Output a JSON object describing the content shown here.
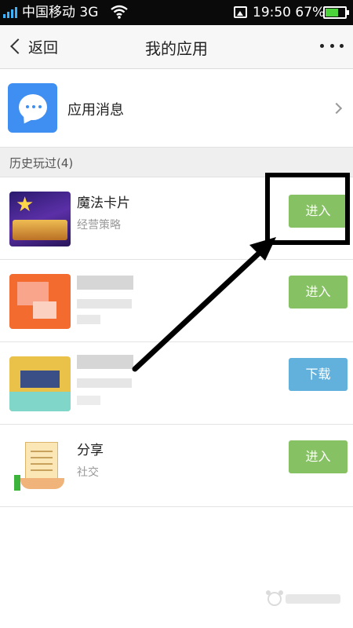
{
  "status_bar": {
    "carrier": "中国移动 3G",
    "time": "19:50 67%",
    "battery_fraction": 0.67,
    "signal_icon": "signal-bars-icon",
    "wifi_icon": "wifi-icon",
    "photo_icon": "image-icon"
  },
  "header": {
    "back_label": "返回",
    "title": "我的应用",
    "more_icon": "more-dots-icon"
  },
  "app_message": {
    "label": "应用消息",
    "icon": "chat-bubble-icon",
    "chevron_icon": "chevron-right-icon"
  },
  "history": {
    "label": "历史玩过(4)"
  },
  "apps": [
    {
      "name": "魔法卡片",
      "category": "经营策略",
      "button_label": "进入",
      "button_color": "#86c163"
    },
    {
      "name": "",
      "category": "",
      "button_label": "进入",
      "button_color": "#86c163"
    },
    {
      "name": "",
      "category": "",
      "button_label": "下载",
      "button_color": "#62b0dc"
    },
    {
      "name": "分享",
      "category": "社交",
      "button_label": "进入",
      "button_color": "#86c163"
    }
  ],
  "colors": {
    "accent_blue": "#3f8ef2",
    "enter_green": "#86c163",
    "download_blue": "#62b0dc"
  }
}
